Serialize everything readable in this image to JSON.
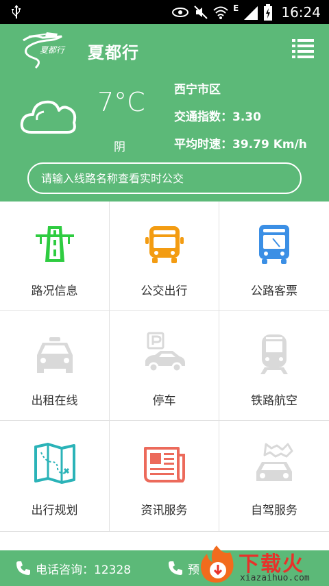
{
  "status_bar": {
    "time": "16:24",
    "network": "E"
  },
  "header": {
    "logo_text": "夏都行",
    "title": "夏都行"
  },
  "weather": {
    "temperature": "7°C",
    "description": "阴",
    "icon": "cloud-icon"
  },
  "traffic": {
    "district": "西宁市区",
    "index_line": "交通指数：3.30",
    "speed_line": "平均时速：39.79 Km/h"
  },
  "search": {
    "placeholder": "请输入线路名称查看实时公交"
  },
  "tiles": [
    {
      "label": "路况信息",
      "icon": "road-icon",
      "color": "#2ecc40"
    },
    {
      "label": "公交出行",
      "icon": "bus-icon",
      "color": "#f39c12"
    },
    {
      "label": "公路客票",
      "icon": "coach-icon",
      "color": "#3b8fe5"
    },
    {
      "label": "出租在线",
      "icon": "taxi-icon",
      "color": "#d9d9d9"
    },
    {
      "label": "停车",
      "icon": "parking-icon",
      "color": "#d9d9d9"
    },
    {
      "label": "铁路航空",
      "icon": "train-icon",
      "color": "#d9d9d9"
    },
    {
      "label": "出行规划",
      "icon": "map-icon",
      "color": "#2bb3b8"
    },
    {
      "label": "资讯服务",
      "icon": "news-icon",
      "color": "#ec6a5b"
    },
    {
      "label": "自驾服务",
      "icon": "self-drive-icon",
      "color": "#d9d9d9"
    }
  ],
  "bottom_bar": {
    "phone_label": "电话咨询：12328",
    "second_label": "预"
  },
  "watermark": {
    "text": "下载火",
    "url": "xiazaihuo.com"
  },
  "colors": {
    "brand_green": "#5cb978",
    "text_dark": "#333333",
    "divider": "#e1e1e1"
  }
}
